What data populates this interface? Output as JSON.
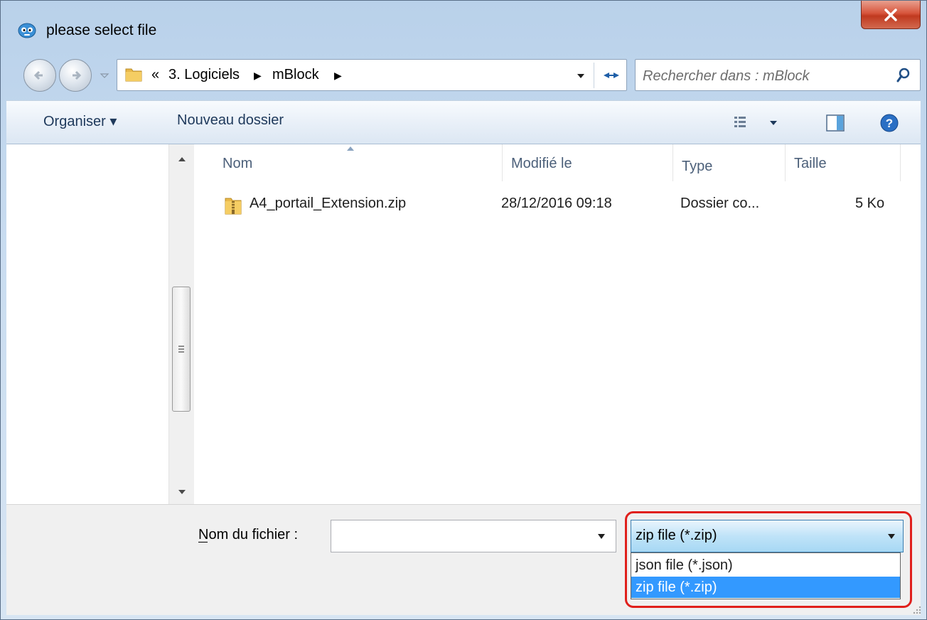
{
  "window": {
    "title": "please select file",
    "close_label": "x"
  },
  "address": {
    "overflow": "«",
    "breadcrumbs": [
      "3. Logiciels",
      "mBlock"
    ]
  },
  "search": {
    "placeholder": "Rechercher dans : mBlock"
  },
  "toolbar": {
    "organize_label": "Organiser ▾",
    "new_folder_label": "Nouveau dossier",
    "icons": [
      "view-options-icon",
      "preview-pane-icon",
      "help-icon"
    ]
  },
  "columns": {
    "name": "Nom",
    "modified": "Modifié le",
    "type": "Type",
    "size": "Taille"
  },
  "files": [
    {
      "name": "A4_portail_Extension.zip",
      "modified": "28/12/2016 09:18",
      "type": "Dossier co...",
      "size": "5 Ko",
      "icon": "zip-folder-icon"
    }
  ],
  "footer": {
    "filename_label": "Nom du fichier :",
    "filename_value": "",
    "filetype_selected": "zip file (*.zip)",
    "filetype_options": [
      "json file (*.json)",
      "zip file (*.zip)"
    ]
  },
  "colors": {
    "highlight_ring": "#e0201c",
    "selected_option": "#3399ff",
    "close_button": "#c0391f"
  }
}
